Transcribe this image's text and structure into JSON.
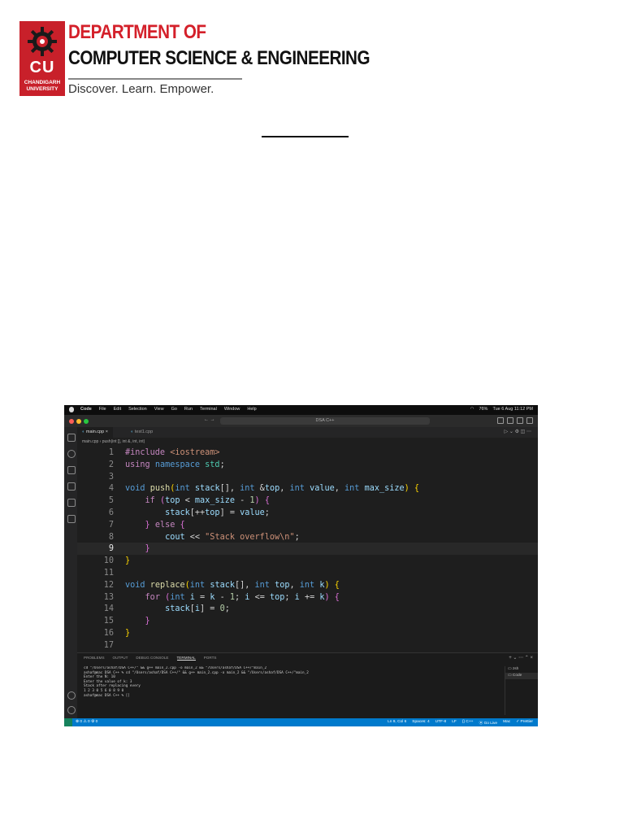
{
  "header": {
    "logo_abbr": "CU",
    "logo_uni_line1": "CHANDIGARH",
    "logo_uni_line2": "UNIVERSITY",
    "dept_line1": "DEPARTMENT OF",
    "dept_line2": "COMPUTER SCIENCE & ENGINEERING",
    "tagline": "Discover. Learn. Empower."
  },
  "screenshot": {
    "mac_menu": [
      "Code",
      "File",
      "Edit",
      "Selection",
      "View",
      "Go",
      "Run",
      "Terminal",
      "Window",
      "Help"
    ],
    "mac_status": {
      "battery": "76%",
      "datetime": "Tue 6 Aug  11:12 PM"
    },
    "search_text": "DSA C++",
    "tabs": [
      {
        "label": "main.cpp",
        "active": true
      },
      {
        "label": "test1.cpp",
        "active": false
      }
    ],
    "breadcrumb": "main.cpp  ›  push(int [], int &, int, int)",
    "code_lines": [
      {
        "n": "1",
        "html": "<span class=\"pp\">#include</span> <span class=\"str\">&lt;iostream&gt;</span>"
      },
      {
        "n": "2",
        "html": "<span class=\"pp\">using</span> <span class=\"kw\">namespace</span> <span class=\"tp\">std</span>;"
      },
      {
        "n": "3",
        "html": ""
      },
      {
        "n": "4",
        "html": "<span class=\"kw\">void</span> <span class=\"fn\">push</span><span class=\"br1\">(</span><span class=\"kw\">int</span> <span class=\"var\">stack</span>[], <span class=\"kw\">int</span> &amp;<span class=\"var\">top</span>, <span class=\"kw\">int</span> <span class=\"var\">value</span>, <span class=\"kw\">int</span> <span class=\"var\">max_size</span><span class=\"br1\">)</span> <span class=\"br1\">{</span>"
      },
      {
        "n": "5",
        "html": "    <span class=\"ctl\">if</span> <span class=\"br2\">(</span><span class=\"var\">top</span> &lt; <span class=\"var\">max_size</span> - <span class=\"num\">1</span><span class=\"br2\">)</span> <span class=\"br2\">{</span>"
      },
      {
        "n": "6",
        "html": "        <span class=\"var\">stack</span>[++<span class=\"var\">top</span>] = <span class=\"var\">value</span>;"
      },
      {
        "n": "7",
        "html": "    <span class=\"br2\">}</span> <span class=\"ctl\">else</span> <span class=\"br2\">{</span>"
      },
      {
        "n": "8",
        "html": "        <span class=\"var\">cout</span> &lt;&lt; <span class=\"str\">\"Stack overflow\\n\"</span>;"
      },
      {
        "n": "9",
        "html": "    <span class=\"br2\">}</span>",
        "cur": true
      },
      {
        "n": "10",
        "html": "<span class=\"br1\">}</span>"
      },
      {
        "n": "11",
        "html": ""
      },
      {
        "n": "12",
        "html": "<span class=\"kw\">void</span> <span class=\"fn\">replace</span><span class=\"br1\">(</span><span class=\"kw\">int</span> <span class=\"var\">stack</span>[], <span class=\"kw\">int</span> <span class=\"var\">top</span>, <span class=\"kw\">int</span> <span class=\"var\">k</span><span class=\"br1\">)</span> <span class=\"br1\">{</span>"
      },
      {
        "n": "13",
        "html": "    <span class=\"ctl\">for</span> <span class=\"br2\">(</span><span class=\"kw\">int</span> <span class=\"var\">i</span> = <span class=\"var\">k</span> - <span class=\"num\">1</span>; <span class=\"var\">i</span> &lt;= <span class=\"var\">top</span>; <span class=\"var\">i</span> += <span class=\"var\">k</span><span class=\"br2\">)</span> <span class=\"br2\">{</span>"
      },
      {
        "n": "14",
        "html": "        <span class=\"var\">stack</span>[<span class=\"var\">i</span>] = <span class=\"num\">0</span>;"
      },
      {
        "n": "15",
        "html": "    <span class=\"br2\">}</span>"
      },
      {
        "n": "16",
        "html": "<span class=\"br1\">}</span>"
      },
      {
        "n": "17",
        "html": ""
      }
    ],
    "panel_tabs": [
      "PROBLEMS",
      "OUTPUT",
      "DEBUG CONSOLE",
      "TERMINAL",
      "PORTS"
    ],
    "panel_active": "TERMINAL",
    "terminal_lines": [
      "cd \"/Users/ashaf/DSA C++/\" && g++ main_2.cpp -o main_2 && \"/Users/ashaf/DSA C++/\"main_2",
      "ashaf@mac DSA C++ % cd \"/Users/ashaf/DSA C++/\" && g++ main_2.cpp -o main_2 && \"/Users/ashaf/DSA C++/\"main_2",
      "Enter the N: 10",
      "Enter the value of k: 3",
      "Stack after replacing every",
      "1 2 3 0 5 6 0 8 9 0",
      "ashaf@mac DSA C++ % []"
    ],
    "terminal_sessions": [
      "zsh",
      "Code"
    ],
    "status_left": "⊗ 0 ⚠ 0   ⚙ 0",
    "status_right": [
      "Ln 9, Col 6",
      "Spaces: 4",
      "UTF-8",
      "LF",
      "{} C++",
      "⦿ Go Live",
      "Mac",
      "✓ Prettier"
    ],
    "colors": {
      "statusbar": "#007acc",
      "editor_bg": "#1e1e1e"
    }
  }
}
